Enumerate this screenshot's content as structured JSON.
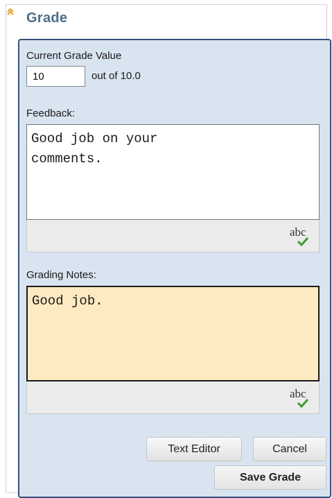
{
  "section": {
    "title": "Grade"
  },
  "grade": {
    "label": "Current Grade Value",
    "value": "10",
    "out_of": "out of 10.0"
  },
  "feedback": {
    "label": "Feedback:",
    "text": "Good job on your\ncomments.",
    "spellcheck_label": "abc"
  },
  "notes": {
    "label": "Grading Notes:",
    "text": "Good job.",
    "spellcheck_label": "abc"
  },
  "buttons": {
    "text_editor": "Text Editor",
    "cancel": "Cancel",
    "save_grade": "Save Grade"
  },
  "colors": {
    "title": "#4d6f8c",
    "panel_bg": "#d9e4f1",
    "panel_border": "#34507a",
    "notes_bg": "#fde9c2",
    "check": "#3c9a2e"
  },
  "icons": {
    "collapse": "double-chevron-up-icon",
    "spellcheck": "spellcheck-icon"
  }
}
